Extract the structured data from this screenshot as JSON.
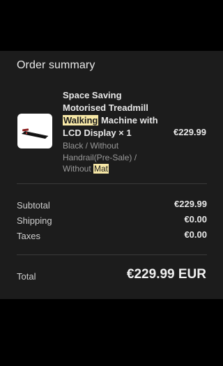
{
  "order_summary": {
    "heading": "Order summary",
    "item": {
      "title_parts": [
        "Space Saving Motorised Treadmill ",
        "Walking",
        " Machine with LCD Display × 1"
      ],
      "variant_parts": [
        "Black / Without Handrail(Pre-Sale) / Without ",
        "Mat"
      ],
      "price": "€229.99",
      "image_icon": "treadmill-icon",
      "highlight_color": "#f6e7a6"
    },
    "subtotal_label": "Subtotal",
    "subtotal_value": "€229.99",
    "shipping_label": "Shipping",
    "shipping_value": "€0.00",
    "taxes_label": "Taxes",
    "taxes_value": "€0.00",
    "total_label": "Total",
    "total_value": "€229.99 EUR"
  }
}
